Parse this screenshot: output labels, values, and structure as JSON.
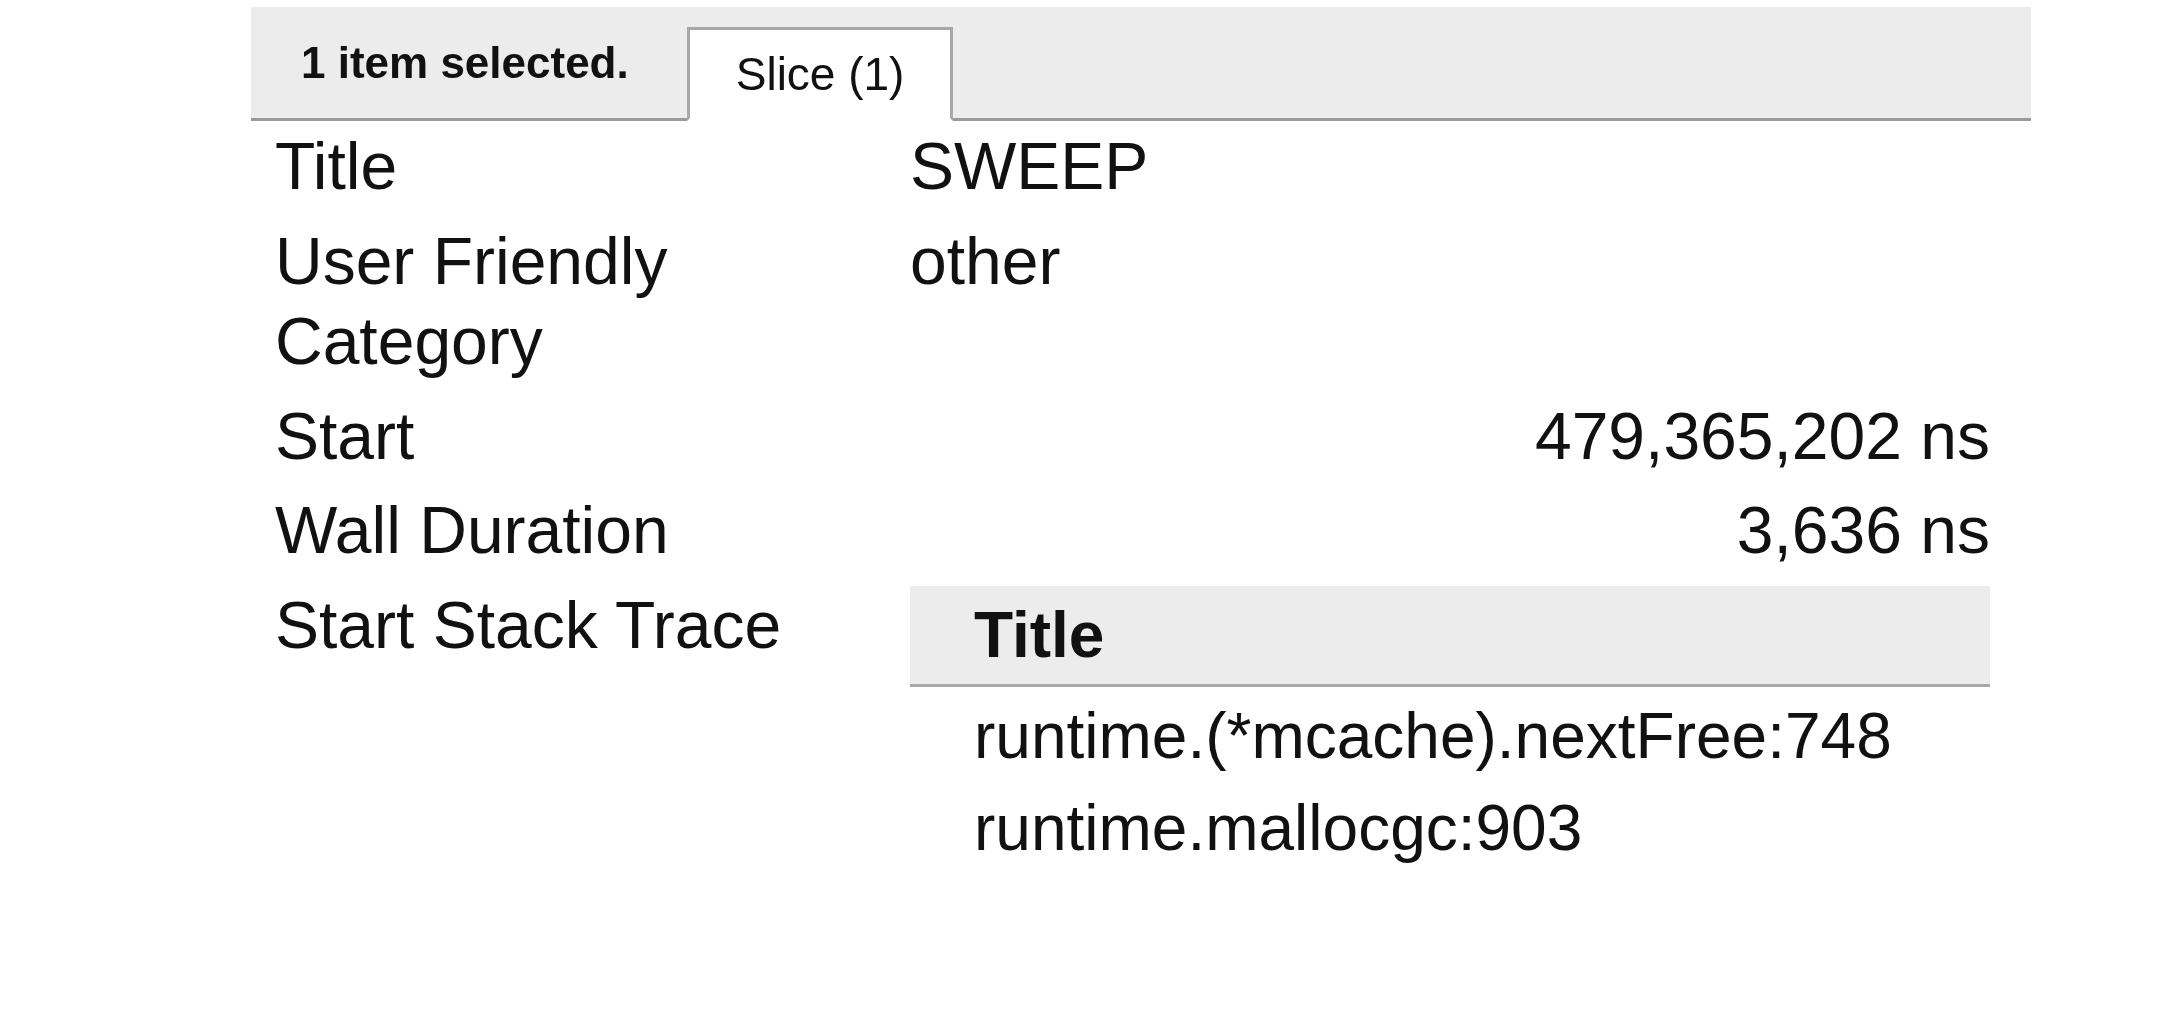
{
  "selection_bar": {
    "status": "1 item selected.",
    "tabs": [
      {
        "label": "Slice (1)",
        "selected": true
      }
    ]
  },
  "properties": [
    {
      "kind": "text",
      "label": "Title",
      "value": "SWEEP"
    },
    {
      "kind": "text",
      "label": "User Friendly Category",
      "value": "other"
    },
    {
      "kind": "number",
      "label": "Start",
      "value": "479,365,202 ns"
    },
    {
      "kind": "number",
      "label": "Wall Duration",
      "value": "3,636 ns"
    },
    {
      "kind": "stack",
      "label": "Start Stack Trace",
      "columns": [
        "Title"
      ],
      "rows": [
        "runtime.(*mcache).nextFree:748",
        "runtime.mallocgc:903"
      ]
    }
  ]
}
